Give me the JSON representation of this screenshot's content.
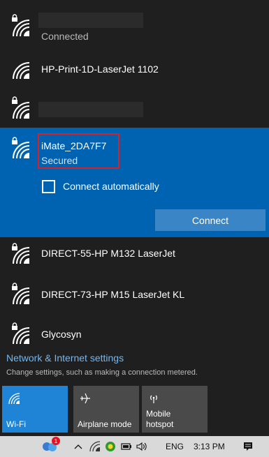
{
  "networks": [
    {
      "name": "",
      "status": "Connected",
      "secured_lock": true,
      "redacted": true
    },
    {
      "name": "HP-Print-1D-LaserJet 1102",
      "status": "",
      "secured_lock": false,
      "redacted": false
    },
    {
      "name": "",
      "status": "",
      "secured_lock": true,
      "redacted": true
    },
    {
      "name": "iMate_2DA7F7",
      "status": "Secured",
      "secured_lock": true,
      "selected": true
    },
    {
      "name": "DIRECT-55-HP M132 LaserJet",
      "status": "",
      "secured_lock": true
    },
    {
      "name": "DIRECT-73-HP M15 LaserJet KL",
      "status": "",
      "secured_lock": true
    },
    {
      "name": "Glycosyn",
      "status": "",
      "secured_lock": true
    }
  ],
  "selected_panel": {
    "connect_auto_label": "Connect automatically",
    "connect_auto_checked": false,
    "connect_button": "Connect"
  },
  "settings": {
    "title": "Network & Internet settings",
    "subtitle": "Change settings, such as making a connection metered."
  },
  "quick_actions": [
    {
      "label": "Wi-Fi",
      "icon": "wifi-icon",
      "active": true
    },
    {
      "label": "Airplane mode",
      "icon": "airplane-icon",
      "active": false
    },
    {
      "label": "Mobile\nhotspot",
      "icon": "hotspot-icon",
      "active": false
    }
  ],
  "taskbar": {
    "badge_count": "1",
    "language": "ENG",
    "time": "3:13 PM"
  },
  "colors": {
    "flyout_bg": "#1f1f1f",
    "selected_bg": "#0063b1",
    "accent_link": "#74b7f0",
    "connect_button_bg": "#3a85c6",
    "wifi_tile_active": "#1f84d6",
    "tile_inactive": "#4a4a4a",
    "highlight_border": "#d2232a"
  }
}
